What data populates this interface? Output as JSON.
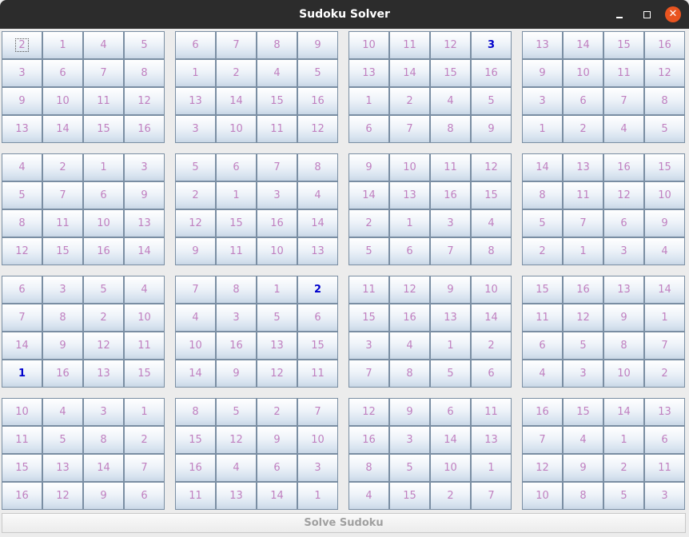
{
  "window": {
    "title": "Sudoku Solver",
    "minimize_icon": "minimize-icon",
    "maximize_icon": "maximize-icon",
    "close_icon": "close-icon",
    "close_color": "#e95420"
  },
  "colors": {
    "value_text": "#c080c0",
    "given_text": "#0000cc"
  },
  "grid": {
    "rows": [
      [
        "2",
        "1",
        "4",
        "5",
        "6",
        "7",
        "8",
        "9",
        "10",
        "11",
        "12",
        "3",
        "13",
        "14",
        "15",
        "16"
      ],
      [
        "3",
        "6",
        "7",
        "8",
        "1",
        "2",
        "4",
        "5",
        "13",
        "14",
        "15",
        "16",
        "9",
        "10",
        "11",
        "12"
      ],
      [
        "9",
        "10",
        "11",
        "12",
        "13",
        "14",
        "15",
        "16",
        "1",
        "2",
        "4",
        "5",
        "3",
        "6",
        "7",
        "8"
      ],
      [
        "13",
        "14",
        "15",
        "16",
        "3",
        "10",
        "11",
        "12",
        "6",
        "7",
        "8",
        "9",
        "1",
        "2",
        "4",
        "5"
      ],
      [
        "4",
        "2",
        "1",
        "3",
        "5",
        "6",
        "7",
        "8",
        "9",
        "10",
        "11",
        "12",
        "14",
        "13",
        "16",
        "15"
      ],
      [
        "5",
        "7",
        "6",
        "9",
        "2",
        "1",
        "3",
        "4",
        "14",
        "13",
        "16",
        "15",
        "8",
        "11",
        "12",
        "10"
      ],
      [
        "8",
        "11",
        "10",
        "13",
        "12",
        "15",
        "16",
        "14",
        "2",
        "1",
        "3",
        "4",
        "5",
        "7",
        "6",
        "9"
      ],
      [
        "12",
        "15",
        "16",
        "14",
        "9",
        "11",
        "10",
        "13",
        "5",
        "6",
        "7",
        "8",
        "2",
        "1",
        "3",
        "4"
      ],
      [
        "6",
        "3",
        "5",
        "4",
        "7",
        "8",
        "1",
        "2",
        "11",
        "12",
        "9",
        "10",
        "15",
        "16",
        "13",
        "14"
      ],
      [
        "7",
        "8",
        "2",
        "10",
        "4",
        "3",
        "5",
        "6",
        "15",
        "16",
        "13",
        "14",
        "11",
        "12",
        "9",
        "1"
      ],
      [
        "14",
        "9",
        "12",
        "11",
        "10",
        "16",
        "13",
        "15",
        "3",
        "4",
        "1",
        "2",
        "6",
        "5",
        "8",
        "7"
      ],
      [
        "1",
        "16",
        "13",
        "15",
        "14",
        "9",
        "12",
        "11",
        "7",
        "8",
        "5",
        "6",
        "4",
        "3",
        "10",
        "2"
      ],
      [
        "10",
        "4",
        "3",
        "1",
        "8",
        "5",
        "2",
        "7",
        "12",
        "9",
        "6",
        "11",
        "16",
        "15",
        "14",
        "13"
      ],
      [
        "11",
        "5",
        "8",
        "2",
        "15",
        "12",
        "9",
        "10",
        "16",
        "3",
        "14",
        "13",
        "7",
        "4",
        "1",
        "6"
      ],
      [
        "15",
        "13",
        "14",
        "7",
        "16",
        "4",
        "6",
        "3",
        "8",
        "5",
        "10",
        "1",
        "12",
        "9",
        "2",
        "11"
      ],
      [
        "16",
        "12",
        "9",
        "6",
        "11",
        "13",
        "14",
        "1",
        "4",
        "15",
        "2",
        "7",
        "10",
        "8",
        "5",
        "3"
      ]
    ],
    "given_cells": [
      [
        0,
        11
      ],
      [
        8,
        7
      ],
      [
        11,
        0
      ]
    ],
    "focused_cell": [
      0,
      0
    ]
  },
  "solve_button": {
    "label": "Solve Sudoku"
  }
}
